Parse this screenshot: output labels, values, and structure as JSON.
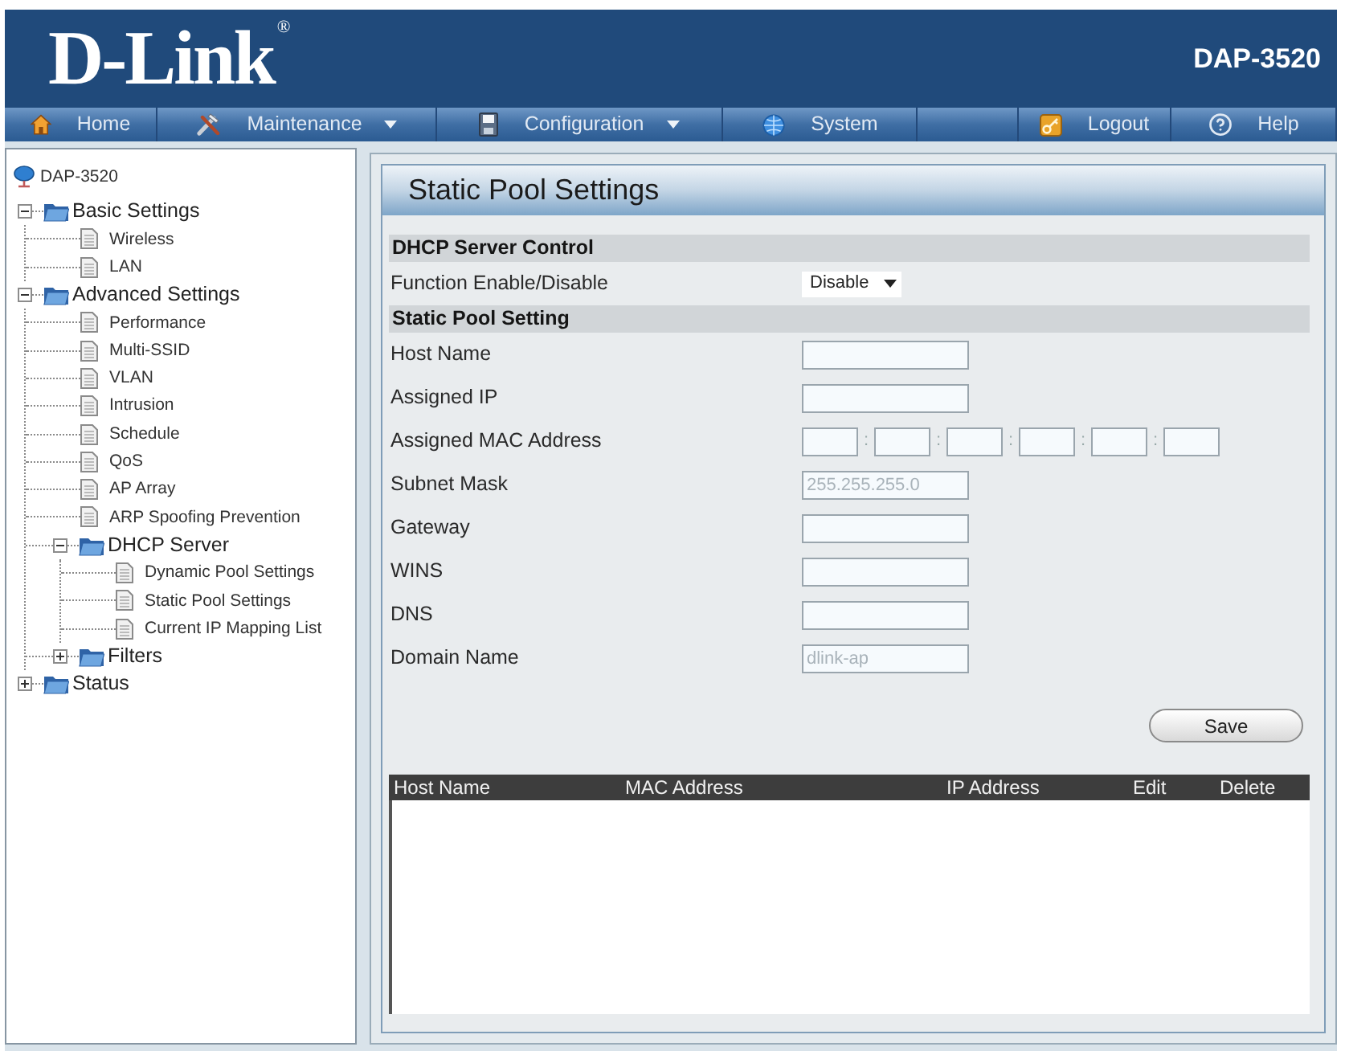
{
  "header": {
    "logo": "D-Link$^{®}$",
    "model": "DAP-3520"
  },
  "menu": [
    {
      "label": "Home",
      "has_menu": false
    },
    {
      "label": "Maintenance",
      "has_menu": true
    },
    {
      "label": "Configuration",
      "has_menu": true
    },
    {
      "label": "System",
      "has_menu": false
    },
    {
      "label": "Logout",
      "has_menu": false
    },
    {
      "label": "Help",
      "has_menu": false
    }
  ],
  "sidebar": {
    "root": "DAP-3520",
    "tree": [
      {
        "label": "Basic Settings",
        "kind": "folder",
        "expanded": true,
        "children": [
          {
            "label": "Wireless",
            "kind": "page"
          },
          {
            "label": "LAN",
            "kind": "page"
          }
        ]
      },
      {
        "label": "Advanced Settings",
        "kind": "folder",
        "expanded": true,
        "children": [
          {
            "label": "Performance",
            "kind": "page"
          },
          {
            "label": "Multi-SSID",
            "kind": "page"
          },
          {
            "label": "VLAN",
            "kind": "page"
          },
          {
            "label": "Intrusion",
            "kind": "page"
          },
          {
            "label": "Schedule",
            "kind": "page"
          },
          {
            "label": "QoS",
            "kind": "page"
          },
          {
            "label": "AP Array",
            "kind": "page"
          },
          {
            "label": "ARP Spoofing Prevention",
            "kind": "page"
          },
          {
            "label": "DHCP Server",
            "kind": "folder",
            "expanded": true,
            "children": [
              {
                "label": "Dynamic Pool Settings",
                "kind": "page"
              },
              {
                "label": "Static Pool Settings",
                "kind": "page"
              },
              {
                "label": "Current IP Mapping List",
                "kind": "page"
              }
            ]
          },
          {
            "label": "Filters",
            "kind": "folder",
            "expanded": false
          }
        ]
      },
      {
        "label": "Status",
        "kind": "folder",
        "expanded": false
      }
    ]
  },
  "panel": {
    "title": "Static Pool Settings",
    "sections": [
      {
        "heading": "DHCP Server Control",
        "rows": [
          {
            "label": "Function Enable/Disable",
            "kind": "select",
            "value": "Disable"
          }
        ]
      },
      {
        "heading": "Static Pool Setting",
        "rows": [
          {
            "label": "Host Name",
            "kind": "text"
          },
          {
            "label": "Assigned IP",
            "kind": "text"
          },
          {
            "label": "Assigned MAC Address",
            "kind": "mac",
            "separators": [
              ":",
              ":",
              ":",
              ":",
              ":"
            ]
          },
          {
            "label": "Subnet Mask",
            "kind": "text",
            "placeholder": "255.255.255.0"
          },
          {
            "label": "Gateway",
            "kind": "text"
          },
          {
            "label": "WINS",
            "kind": "text"
          },
          {
            "label": "DNS",
            "kind": "text"
          },
          {
            "label": "Domain Name",
            "kind": "text",
            "placeholder": "dlink-ap"
          }
        ]
      }
    ],
    "save_button": "Save",
    "table": {
      "columns": [
        "Host Name",
        "MAC Address",
        "IP Address",
        "Edit",
        "Delete"
      ]
    }
  }
}
